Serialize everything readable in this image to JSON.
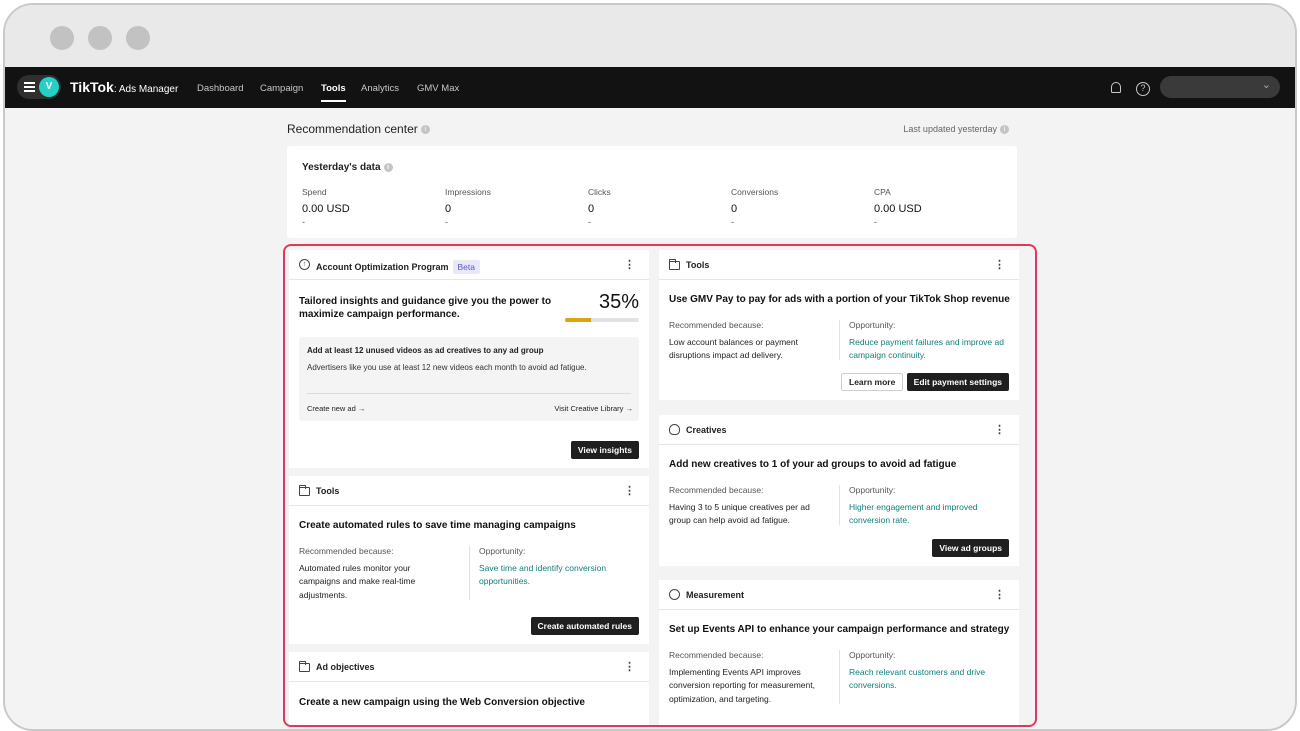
{
  "nav": {
    "avatar_letter": "V",
    "brand": "TikTok",
    "brand_sub": ": Ads Manager",
    "items": [
      "Dashboard",
      "Campaign",
      "Tools",
      "Analytics",
      "GMV Max"
    ],
    "active": "Tools"
  },
  "page": {
    "title": "Recommendation center",
    "last_updated": "Last updated yesterday"
  },
  "yesterday": {
    "title": "Yesterday's data",
    "metrics": [
      {
        "label": "Spend",
        "value": "0.00 USD",
        "delta": "-"
      },
      {
        "label": "Impressions",
        "value": "0",
        "delta": "-"
      },
      {
        "label": "Clicks",
        "value": "0",
        "delta": "-"
      },
      {
        "label": "Conversions",
        "value": "0",
        "delta": "-"
      },
      {
        "label": "CPA",
        "value": "0.00 USD",
        "delta": "-"
      }
    ]
  },
  "aop": {
    "header": "Account Optimization Program",
    "badge": "Beta",
    "title": "Tailored insights and guidance give you the power to maximize campaign performance.",
    "percent": "35%",
    "progress_fraction": 0.35,
    "tip_title": "Add at least 12 unused videos as ad creatives to any ad group",
    "tip_body": "Advertisers like you use at least 12 new videos each month to avoid ad fatigue.",
    "link_left": "Create new ad →",
    "link_right": "Visit Creative Library →",
    "button": "View insights"
  },
  "tools_rules": {
    "header": "Tools",
    "title": "Create automated rules to save time managing campaigns",
    "rec_label": "Recommended because:",
    "rec_text": "Automated rules monitor your campaigns and make real-time adjustments.",
    "opp_label": "Opportunity:",
    "opp_text": "Save time and identify conversion opportunities.",
    "button": "Create automated rules"
  },
  "ad_objectives": {
    "header": "Ad objectives",
    "title": "Create a new campaign using the Web Conversion objective"
  },
  "tools_gmv": {
    "header": "Tools",
    "title": "Use GMV Pay to pay for ads with a portion of your TikTok Shop revenue",
    "rec_label": "Recommended because:",
    "rec_text": "Low account balances or payment disruptions impact ad delivery.",
    "opp_label": "Opportunity:",
    "opp_text": "Reduce payment failures and improve ad campaign continuity.",
    "button_secondary": "Learn more",
    "button_primary": "Edit payment settings"
  },
  "creatives": {
    "header": "Creatives",
    "title": "Add new creatives to 1 of your ad groups to avoid ad fatigue",
    "rec_label": "Recommended because:",
    "rec_text": "Having 3 to 5 unique creatives per ad group can help avoid ad fatigue.",
    "opp_label": "Opportunity:",
    "opp_text": "Higher engagement and improved conversion rate.",
    "button": "View ad groups"
  },
  "measurement": {
    "header": "Measurement",
    "title": "Set up Events API to enhance your campaign performance and strategy",
    "rec_label": "Recommended because:",
    "rec_text": "Implementing Events API improves conversion reporting for measurement, optimization, and targeting.",
    "opp_label": "Opportunity:",
    "opp_text": "Reach relevant customers and drive conversions."
  },
  "colors": {
    "highlight_border": "#e0375a",
    "link_teal": "#0f7f7a",
    "progress_fill": "#d9a610",
    "beta_bg": "#e9e8fa"
  }
}
